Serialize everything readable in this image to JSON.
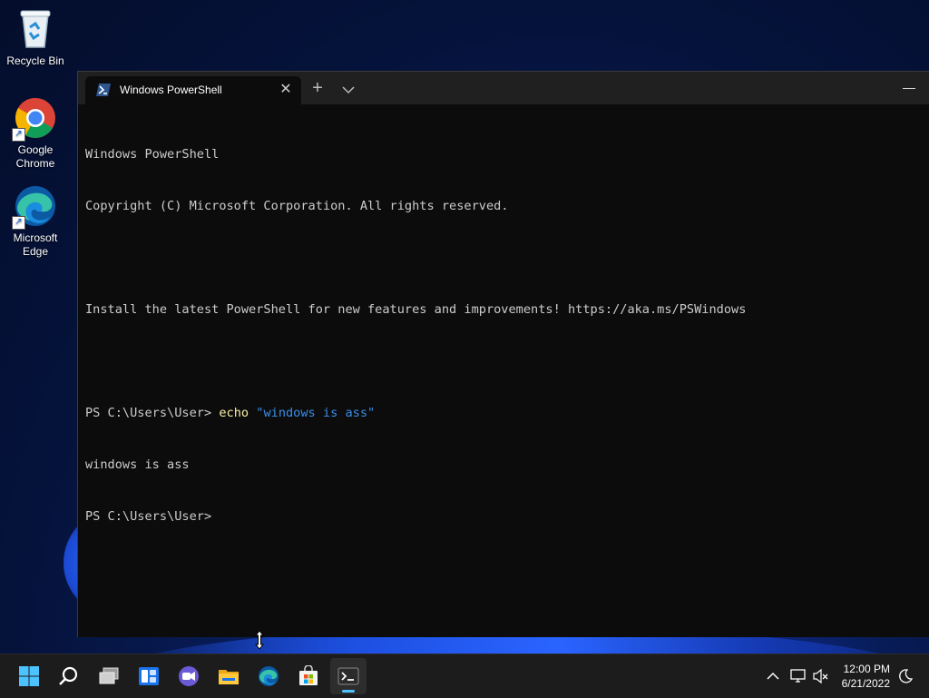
{
  "desktop": {
    "icons": [
      {
        "label": "Recycle Bin",
        "icon": "recycle-bin-icon"
      },
      {
        "label": "Google Chrome",
        "icon": "chrome-icon"
      },
      {
        "label": "Microsoft Edge",
        "icon": "edge-icon"
      }
    ]
  },
  "terminal": {
    "tab_title": "Windows PowerShell",
    "tab_icon": "powershell-icon",
    "lines": [
      "Windows PowerShell",
      "Copyright (C) Microsoft Corporation. All rights reserved.",
      "",
      "Install the latest PowerShell for new features and improvements! https://aka.ms/PSWindows",
      "",
      "PS C:\\Users\\User> ",
      "windows is ass",
      "PS C:\\Users\\User>"
    ],
    "command_prompt": "PS C:\\Users\\User> ",
    "command_name": "echo",
    "command_arg": "\"windows is ass\""
  },
  "taskbar": {
    "apps": [
      "start-icon",
      "search-icon",
      "task-view-icon",
      "widgets-icon",
      "chat-icon",
      "file-explorer-icon",
      "edge-icon",
      "store-icon",
      "terminal-icon"
    ],
    "active_app": "terminal-icon",
    "clock_time": "12:00 PM",
    "clock_date": "6/21/2022",
    "tray": [
      "chevron-up-icon",
      "network-icon",
      "volume-muted-icon",
      "quiet-hours-icon"
    ]
  },
  "colors": {
    "accent": "#4cc2ff",
    "console_bg": "#0c0c0c",
    "command_yellow": "#f9f1a5",
    "string_blue": "#3b8eea"
  }
}
